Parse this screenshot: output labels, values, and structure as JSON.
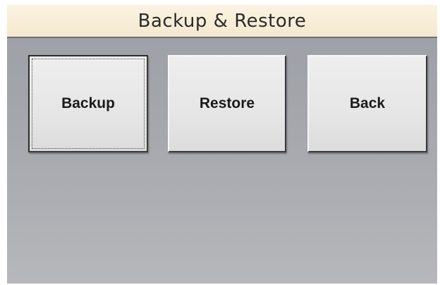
{
  "header": {
    "title": "Backup & Restore"
  },
  "buttons": {
    "backup_label": "Backup",
    "restore_label": "Restore",
    "back_label": "Back",
    "focused": "Backup"
  },
  "colors": {
    "title_bar": "#f4e8cf",
    "screen_background": "#a3a5ab",
    "button_face": "#e6e6e6"
  }
}
